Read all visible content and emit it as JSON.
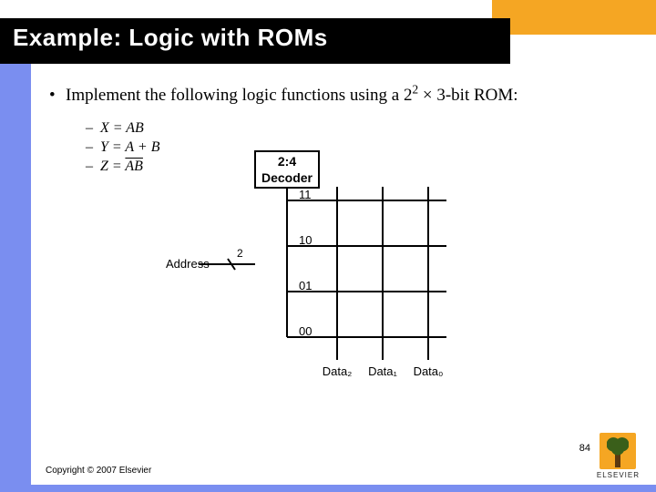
{
  "title": "Example: Logic with ROMs",
  "bullet": {
    "prefix": "Implement the following logic functions using a 2",
    "sup": "2",
    "suffix": " × 3-bit ROM:"
  },
  "equations": {
    "x": "X = AB",
    "y": "Y = A + B",
    "z_lhs": "Z = ",
    "z_rhs": "AB"
  },
  "diagram": {
    "decoder_top": "2:4",
    "decoder_bottom": "Decoder",
    "address": "Address",
    "address_width": "2",
    "rows": [
      "11",
      "10",
      "01",
      "00"
    ],
    "outputs": [
      "Data₂",
      "Data₁",
      "Data₀"
    ]
  },
  "footer": {
    "copyright": "Copyright © 2007 Elsevier",
    "page": "84",
    "publisher": "ELSEVIER"
  }
}
